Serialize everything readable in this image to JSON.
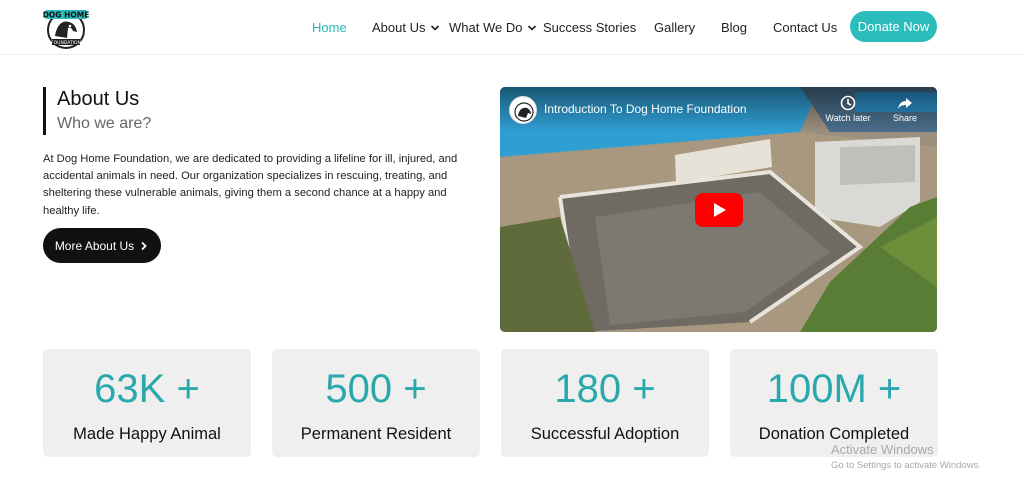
{
  "brand": {
    "logo_text": "DOG HOME",
    "logo_subtext": "FOUNDATION"
  },
  "nav": {
    "items": [
      {
        "label": "Home",
        "active": true
      },
      {
        "label": "About Us",
        "has_dropdown": true
      },
      {
        "label": "What We Do",
        "has_dropdown": true
      },
      {
        "label": "Success Stories"
      },
      {
        "label": "Gallery"
      },
      {
        "label": "Blog"
      },
      {
        "label": "Contact Us"
      }
    ],
    "cta": "Donate Now"
  },
  "about": {
    "title": "About Us",
    "subtitle": "Who we are?",
    "body": "At Dog Home Foundation, we are dedicated to providing a lifeline for ill, injured, and accidental animals in need. Our organization specializes in rescuing, treating, and sheltering these vulnerable animals, giving them a second chance at a happy and healthy life.",
    "button": "More About Us",
    "button_icon": "chevron-right-icon"
  },
  "video": {
    "title": "Introduction To Dog Home Foundation",
    "watch_later": "Watch later",
    "share": "Share",
    "play_icon": "youtube-play-icon"
  },
  "stats": [
    {
      "value": "63K +",
      "label": "Made Happy Animal"
    },
    {
      "value": "500 +",
      "label": "Permanent Resident"
    },
    {
      "value": "180 +",
      "label": "Successful Adoption"
    },
    {
      "value": "100M +",
      "label": "Donation Completed"
    }
  ],
  "watermark": {
    "title": "Activate Windows",
    "subtitle": "Go to Settings to activate Windows."
  },
  "colors": {
    "accent": "#2bbcbc",
    "stat_text": "#2aa9ad",
    "dark_button": "#111111",
    "stat_bg": "#efefef"
  }
}
